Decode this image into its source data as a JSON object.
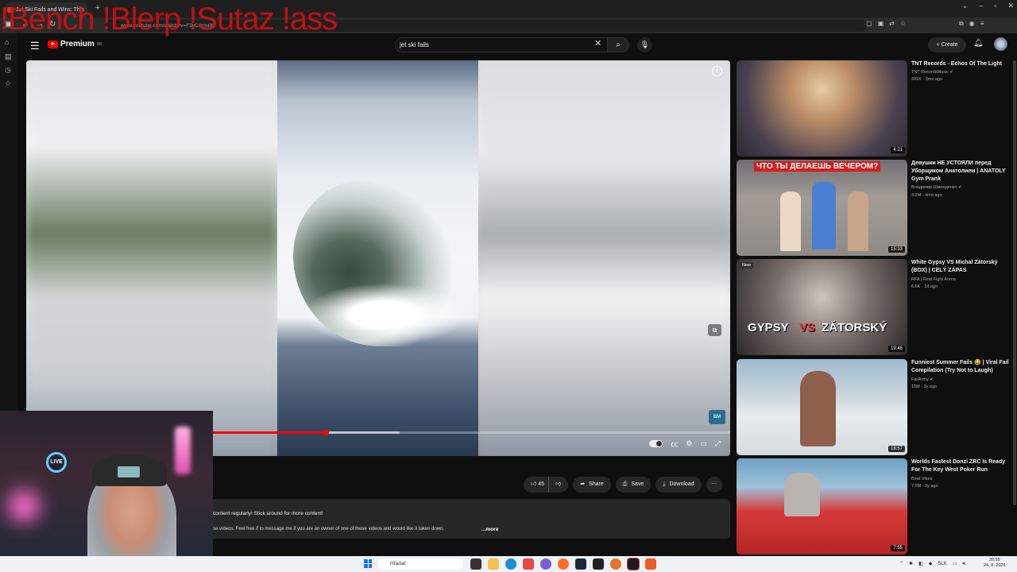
{
  "browser": {
    "tab_title": "Jet Ski Fails and Wins: This",
    "url": "www.youtube.com/watch?v=F3yCJzmt8I",
    "overlay_text": "!Bench !Blerp !Sutaz !ass"
  },
  "header": {
    "logo_text": "Premium",
    "logo_region": "SK",
    "search_value": "jet ski fails",
    "create_label": "Create"
  },
  "player": {
    "progress_fraction": 0.426,
    "buffer_fraction": 0.53
  },
  "actions": {
    "likes": "45",
    "share_label": "Share",
    "save_label": "Save",
    "download_label": "Download"
  },
  "description": {
    "line1": "content regularly! Stick around for more content!",
    "line2": "se videos. Feel free if to message me if you are an owner of one of these videos and would like it taken down.",
    "more": "...more"
  },
  "webcam": {
    "live_label": "LIVE"
  },
  "recommendations": [
    {
      "title": "TNT Records - Echos Of The Light",
      "channel": "TNT RecordsMusic",
      "meta": "391K · 3mo ago",
      "duration": "4:21",
      "verified": true,
      "is_new": false,
      "thumb_text": ""
    },
    {
      "title": "Девушки НЕ УСТОЯЛИ перед Уборщиком Анатолием | ANATOLY Gym Prank",
      "channel": "Владимир Шмонденко",
      "meta": "3.2M · 4mo ago",
      "duration": "15:33",
      "verified": true,
      "is_new": false,
      "thumb_text": "ЧТО ТЫ ДЕЛАЕШЬ ВЕЧЕРОМ?"
    },
    {
      "title": "White Gypsy VS Michal Zátorský (BOX) | CELÝ ZÁPAS",
      "channel": "RFA | Real Fight Arena",
      "meta": "6.6K · 1d ago",
      "duration": "19:46",
      "verified": false,
      "is_new": true,
      "new_label": "New",
      "thumb_text_a": "GYPSY",
      "thumb_text_b": "VS",
      "thumb_text_c": "ZÁTORSKÝ"
    },
    {
      "title": "Funniest Summer Fails 😂 | Viral Fail Compilation (Try Not to Laugh)",
      "channel": "FailArmy",
      "meta": "15M · 3y ago",
      "duration": "18:57",
      "verified": true,
      "is_new": false,
      "thumb_text": ""
    },
    {
      "title": "Worlds Fastest Donzi ZRC Is Ready For The Key West Poker Run",
      "channel": "Boat Vibes",
      "meta": "7.9M · 3y ago",
      "duration": "7:55",
      "verified": false,
      "is_new": false,
      "thumb_text": ""
    }
  ],
  "taskbar": {
    "search_placeholder": "Hľadať",
    "lang": "SLK",
    "time": "20:55",
    "date": "24. 8. 2026"
  }
}
